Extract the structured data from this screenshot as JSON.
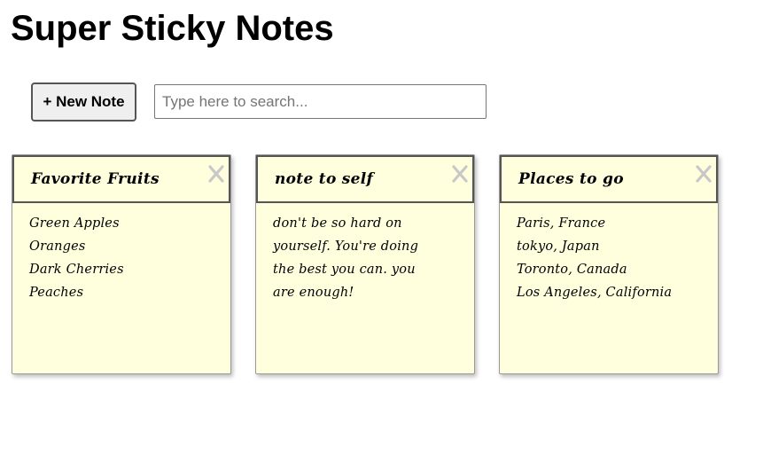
{
  "app": {
    "title": "Super Sticky Notes"
  },
  "toolbar": {
    "new_note_label": "+ New Note",
    "search_placeholder": "Type here to search...",
    "search_value": ""
  },
  "notes": [
    {
      "title": "Favorite Fruits",
      "lines": [
        "Green Apples",
        "Oranges",
        "Dark Cherries",
        "Peaches"
      ]
    },
    {
      "title": "note to self",
      "lines": [
        "don't be so hard on",
        "yourself. You're doing",
        "the best you can. you",
        "are enough!"
      ]
    },
    {
      "title": "Places to go",
      "lines": [
        "Paris, France",
        "tokyo, Japan",
        "Toronto, Canada",
        "Los Angeles, California"
      ]
    }
  ],
  "icons": {
    "close": "close-icon"
  },
  "colors": {
    "note_background": "#ffffde",
    "close_icon": "#c8c8c8"
  }
}
